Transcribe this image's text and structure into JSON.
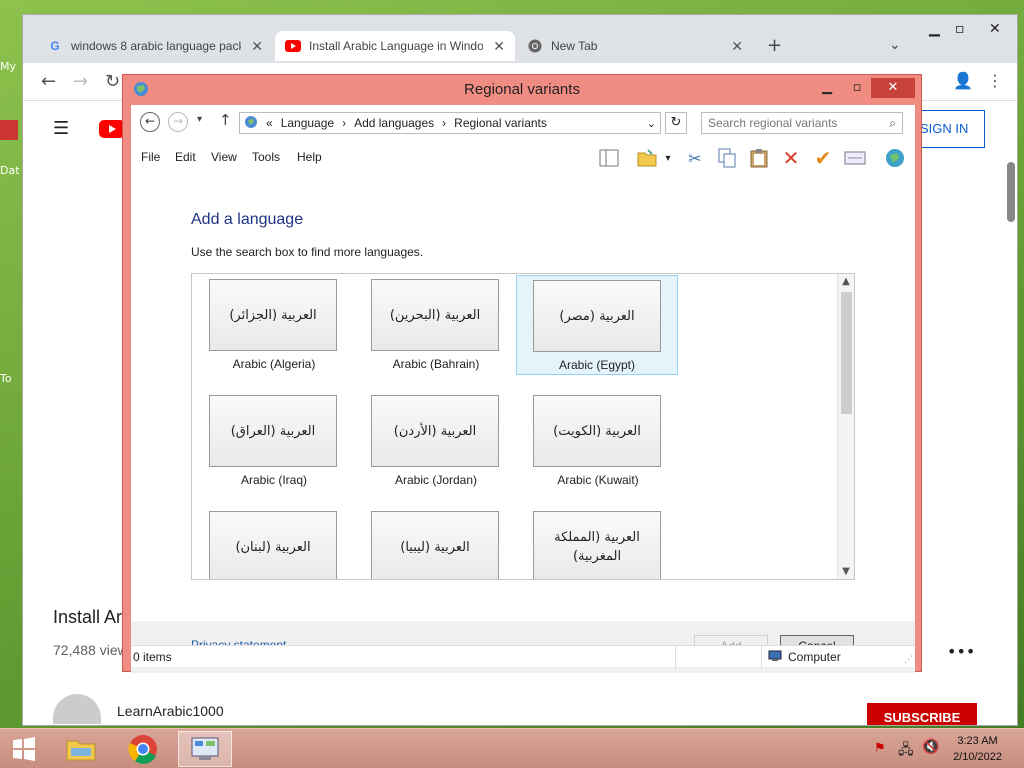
{
  "desktop": {
    "icons": [
      {
        "label": "My"
      },
      {
        "label": "Dat"
      },
      {
        "label": "To"
      }
    ]
  },
  "browser": {
    "tabs": [
      {
        "title": "windows 8 arabic language pack",
        "icon": "google-g-icon",
        "active": false
      },
      {
        "title": "Install Arabic Language in Windo",
        "icon": "youtube-icon",
        "active": true
      },
      {
        "title": "New Tab",
        "icon": "chrome-icon",
        "active": false
      }
    ],
    "new_tab_label": "+",
    "youtube": {
      "sign_in_label": "SIGN IN",
      "video_title": "Install Ar",
      "views": "72,488 view",
      "channel": "LearnArabic1000",
      "subscribe_label": "SUBSCRIBE"
    }
  },
  "dialog": {
    "title": "Regional variants",
    "breadcrumb": {
      "prefix": "«",
      "items": [
        "Language",
        "Add languages",
        "Regional variants"
      ]
    },
    "search": {
      "placeholder": "Search regional variants"
    },
    "menu": [
      "File",
      "Edit",
      "View",
      "Tools",
      "Help"
    ],
    "heading": "Add a language",
    "hint": "Use the search box to find more languages.",
    "languages": [
      {
        "native": "العربية (الجزائر)",
        "name": "Arabic (Algeria)",
        "selected": false
      },
      {
        "native": "العربية (البحرين)",
        "name": "Arabic (Bahrain)",
        "selected": false
      },
      {
        "native": "العربية (مصر)",
        "name": "Arabic (Egypt)",
        "selected": true
      },
      {
        "native": "العربية (العراق)",
        "name": "Arabic (Iraq)",
        "selected": false
      },
      {
        "native": "العربية (الأردن)",
        "name": "Arabic (Jordan)",
        "selected": false
      },
      {
        "native": "العربية (الكويت)",
        "name": "Arabic (Kuwait)",
        "selected": false
      },
      {
        "native": "العربية (لبنان)",
        "name": "",
        "selected": false
      },
      {
        "native": "العربية (ليبيا)",
        "name": "",
        "selected": false
      },
      {
        "native": "العربية (المملكة المغربية)",
        "name": "",
        "selected": false
      }
    ],
    "privacy_label": "Privacy statement",
    "add_label": "Add",
    "cancel_label": "Cancel",
    "status": {
      "items": "0 items",
      "location": "Computer"
    }
  },
  "taskbar": {
    "time": "3:23 AM",
    "date": "2/10/2022"
  },
  "colors": {
    "dialog_frame": "#f18c82",
    "close_button": "#c7423a",
    "youtube_red": "#ff0000",
    "link_blue": "#1f5faa",
    "heading_blue": "#1e3287"
  }
}
